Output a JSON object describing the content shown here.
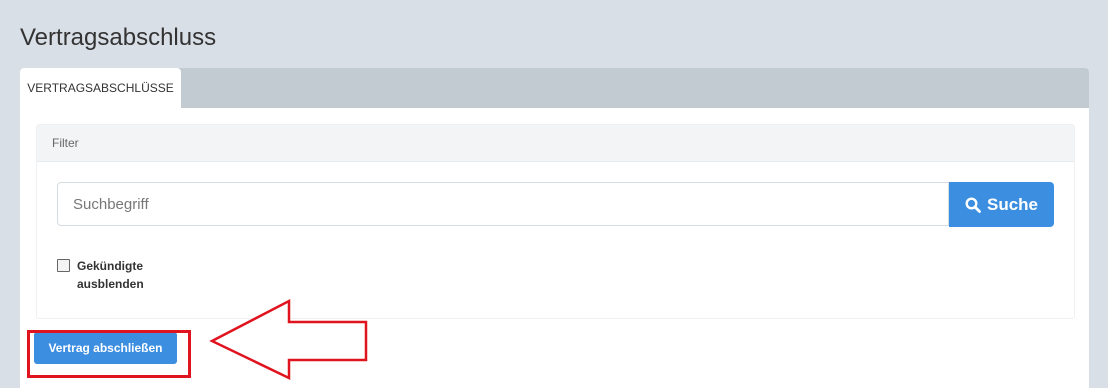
{
  "page": {
    "title": "Vertragsabschluss"
  },
  "tabs": [
    {
      "label": "VERTRAGSABSCHLÜSSE",
      "active": true
    }
  ],
  "filter": {
    "heading": "Filter",
    "search": {
      "placeholder": "Suchbegriff",
      "value": ""
    },
    "search_button": {
      "label": "Suche",
      "icon": "search-icon"
    },
    "checkbox": {
      "label": "Gekündigte ausblenden",
      "checked": false
    }
  },
  "actions": {
    "primary_label": "Vertrag abschließen"
  },
  "colors": {
    "background": "#d9dfe7",
    "accent": "#3c8ee0",
    "tabbar": "#c2cbd2",
    "annotation": "#e0141f"
  }
}
